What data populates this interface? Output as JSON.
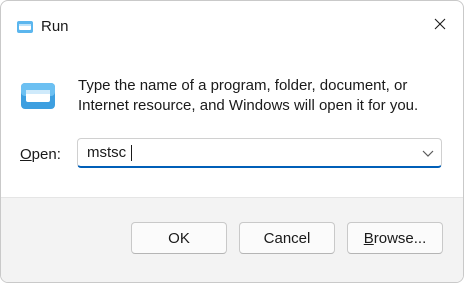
{
  "window": {
    "title": "Run",
    "title_icon": "run-icon",
    "close_icon": "close-icon"
  },
  "dialog": {
    "icon": "run-icon",
    "description": "Type the name of a program, folder, document, or Internet resource, and Windows will open it for you.",
    "open_label_prefix": "",
    "open_label_accel": "O",
    "open_label_rest": "pen:",
    "open_value": "mstsc",
    "dropdown_icon": "chevron-down-icon"
  },
  "buttons": {
    "ok": "OK",
    "cancel": "Cancel",
    "browse_prefix": "",
    "browse_accel": "B",
    "browse_rest": "rowse..."
  },
  "colors": {
    "accent": "#005fb8",
    "footer_bg": "#f3f3f3",
    "icon_blue": "#4aa8e8"
  }
}
